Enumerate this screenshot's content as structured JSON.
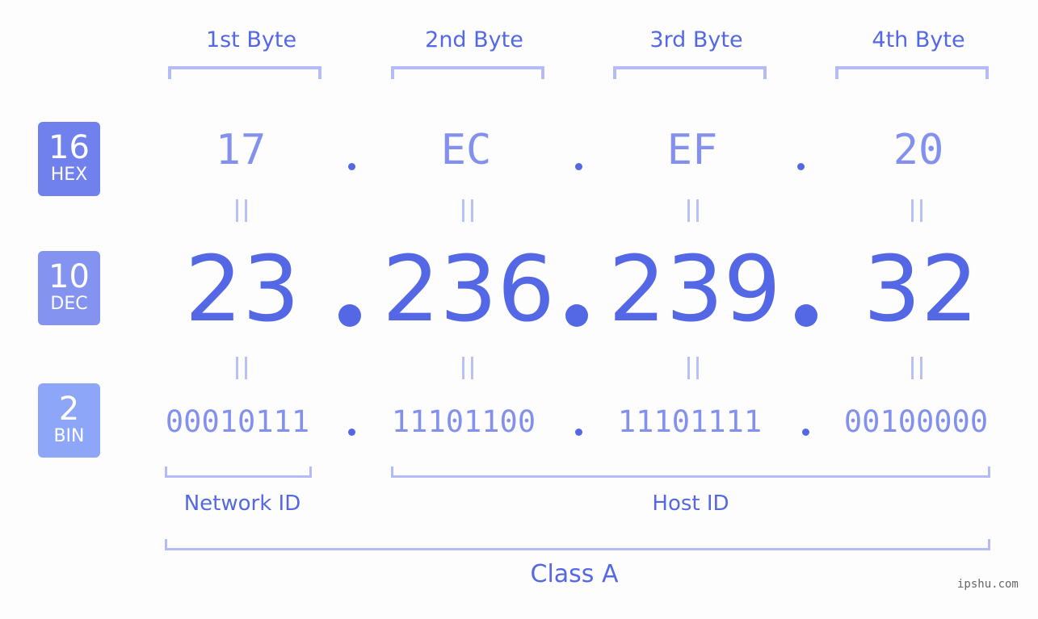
{
  "bytes": [
    {
      "label": "1st Byte",
      "hex": "17",
      "dec": "23",
      "bin": "00010111"
    },
    {
      "label": "2nd Byte",
      "hex": "EC",
      "dec": "236",
      "bin": "11101100"
    },
    {
      "label": "3rd Byte",
      "hex": "EF",
      "dec": "239",
      "bin": "11101111"
    },
    {
      "label": "4th Byte",
      "hex": "20",
      "dec": "32",
      "bin": "00100000"
    }
  ],
  "badges": {
    "hex": {
      "num": "16",
      "unit": "HEX",
      "color": "#7080ec"
    },
    "dec": {
      "num": "10",
      "unit": "DEC",
      "color": "#8492f0"
    },
    "bin": {
      "num": "2",
      "unit": "BIN",
      "color": "#8ea6f8"
    }
  },
  "separator": ".",
  "network_id_label": "Network ID",
  "host_id_label": "Host ID",
  "class_label": "Class A",
  "watermark": "ipshu.com",
  "colors": {
    "accent": "#5468e6",
    "light": "#8490ee",
    "bracket": "#b4bcf7",
    "background": "#fcfdfc"
  }
}
